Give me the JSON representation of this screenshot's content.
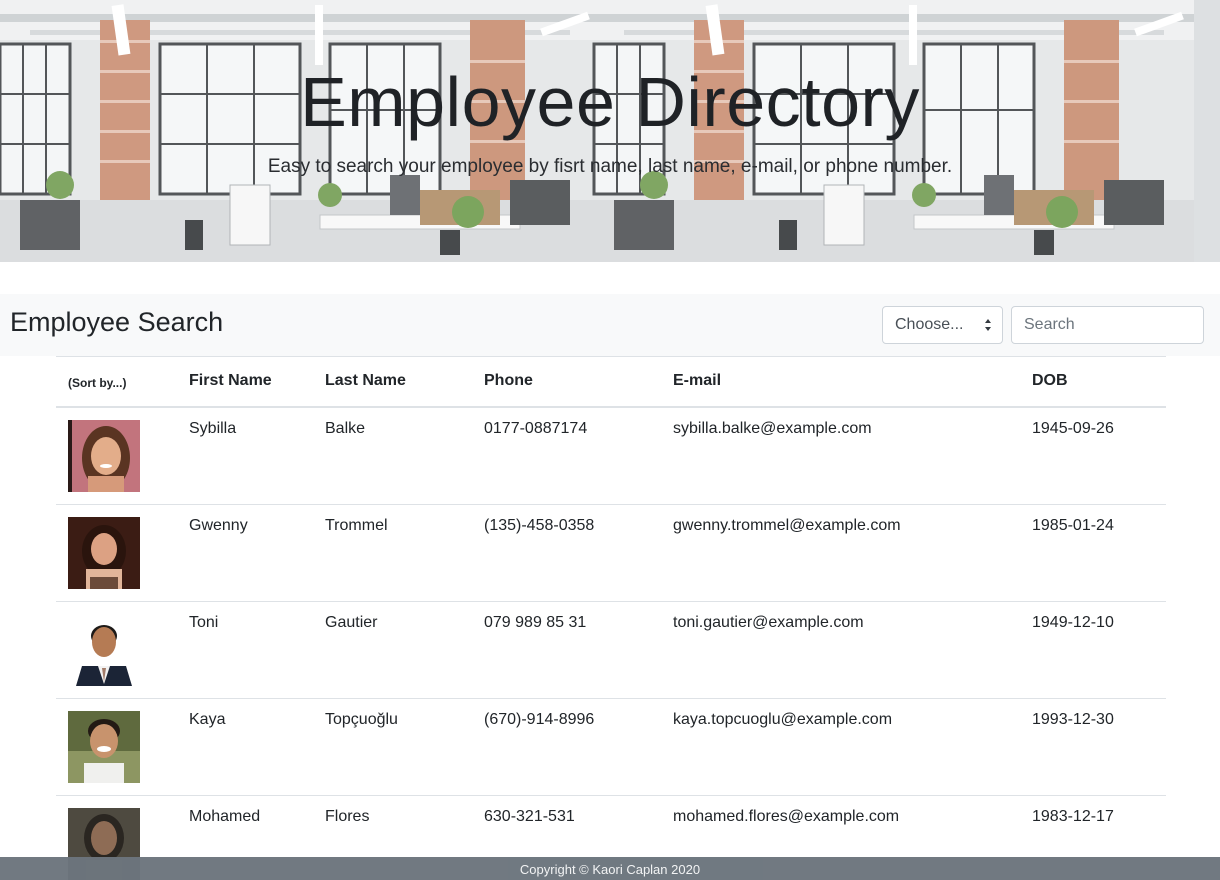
{
  "hero": {
    "title": "Employee Directory",
    "subtitle": "Easy to search your employee by fisrt name, last name, e-mail, or phone number."
  },
  "search": {
    "title": "Employee Search",
    "select_value": "Choose...",
    "placeholder": "Search"
  },
  "table": {
    "headers": {
      "sort": "(Sort by...)",
      "first": "First Name",
      "last": "Last Name",
      "phone": "Phone",
      "email": "E-mail",
      "dob": "DOB"
    },
    "rows": [
      {
        "first": "Sybilla",
        "last": "Balke",
        "phone": "0177-0887174",
        "email": "sybilla.balke@example.com",
        "dob": "1945-09-26"
      },
      {
        "first": "Gwenny",
        "last": "Trommel",
        "phone": "(135)-458-0358",
        "email": "gwenny.trommel@example.com",
        "dob": "1985-01-24"
      },
      {
        "first": "Toni",
        "last": "Gautier",
        "phone": "079 989 85 31",
        "email": "toni.gautier@example.com",
        "dob": "1949-12-10"
      },
      {
        "first": "Kaya",
        "last": "Topçuoğlu",
        "phone": "(670)-914-8996",
        "email": "kaya.topcuoglu@example.com",
        "dob": "1993-12-30"
      },
      {
        "first": "Mohamed",
        "last": "Flores",
        "phone": "630-321-531",
        "email": "mohamed.flores@example.com",
        "dob": "1983-12-17"
      }
    ]
  },
  "footer": {
    "text": "Copyright © Kaori Caplan 2020"
  },
  "colors": {
    "footer_bg": "#6c757d",
    "searchbar_bg": "#f8f9fa",
    "border": "#dee2e6"
  }
}
